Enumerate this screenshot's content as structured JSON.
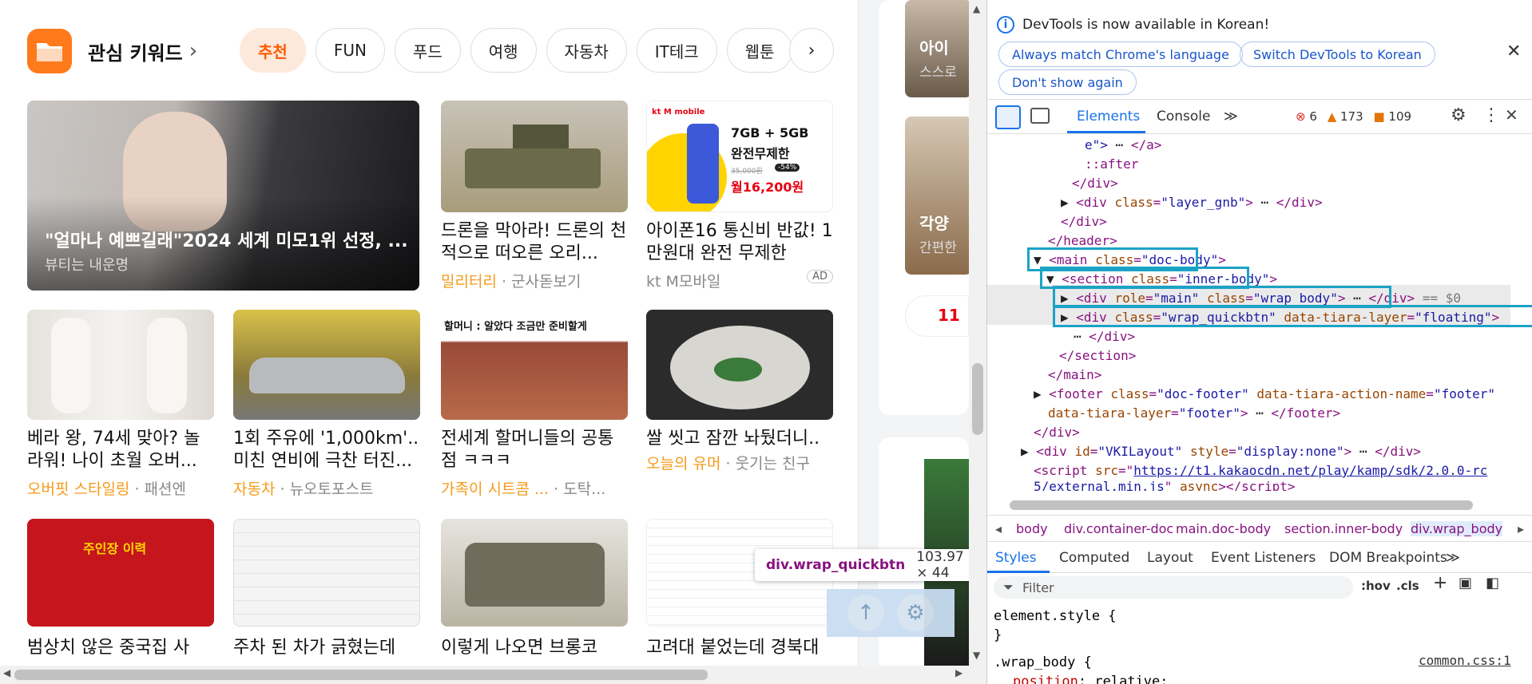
{
  "page": {
    "keyword_title": "관심 키워드",
    "chips": [
      "추천",
      "FUN",
      "푸드",
      "여행",
      "자동차",
      "IT테크",
      "웹툰"
    ],
    "hero": {
      "title": "\"얼마나 예쁘길래\"2024 세계 미모1위 선정, ...",
      "sub": "뷰티는 내운명"
    },
    "cards_row1": [
      {
        "title": "드론을 막아라! 드론의 천적으로 떠오른 오리...",
        "cat": "밀리터리",
        "src": "군사돋보기"
      },
      {
        "title": "아이폰16 통신비 반값! 1만원대 완전 무제한",
        "cat": "",
        "src": "kt M모바일",
        "ad": "AD"
      }
    ],
    "cards_row2": [
      {
        "title": "베라 왕, 74세 맞아? 놀라워! 나이 초월 오버...",
        "cat": "오버핏 스타일링",
        "src": "패션엔"
      },
      {
        "title": "1회 주유에 '1,000km'.. 미친 연비에 극찬 터진...",
        "cat": "자동차",
        "src": "뉴오토포스트"
      },
      {
        "title": "전세계 할머니들의 공통점 ㅋㅋㅋ",
        "cat": "가족이 시트콤 ...",
        "src": "도탁..."
      },
      {
        "title": "쌀 씻고 잠깐 놔뒀더니..",
        "cat": "오늘의 유머",
        "src": "웃기는 친구"
      }
    ],
    "cards_row3": [
      {
        "title": "범상치 않은 중국집 사"
      },
      {
        "title": "주차 된 차가 긁혔는데"
      },
      {
        "title": "이렇게 나오면 브롱코"
      },
      {
        "title": "고려대 붙었는데 경북대"
      }
    ],
    "ad_banner": {
      "line1": "7GB + 5GB",
      "line2": "완전무제한",
      "price_old": "35,000원",
      "badge": "-54%",
      "price": "월16,200원",
      "brand": "kt M mobile"
    },
    "thumb_text": {
      "grandma": "할머니 : 알았다 조금만 준비할게",
      "chinese": "주인장 이력"
    },
    "side": {
      "t1": "아이 ",
      "t1b": "스스로",
      "t2": "각양",
      "t2b": "간편한",
      "logo": "11"
    },
    "tooltip": {
      "selector": "div.wrap_quickbtn",
      "size": "103.97 × 44"
    }
  },
  "devtools": {
    "notice": "DevTools is now available in Korean!",
    "btn_match": "Always match Chrome's language",
    "btn_switch": "Switch DevTools to Korean",
    "btn_dont": "Don't show again",
    "tabs": {
      "elements": "Elements",
      "console": "Console",
      "more": "≫"
    },
    "counts": {
      "errors": "6",
      "warnings": "173",
      "issues": "109"
    },
    "crumbs": [
      "body",
      "div.container-doc",
      "main.doc-body",
      "section.inner-body",
      "div.wrap_body"
    ],
    "style_tabs": [
      "Styles",
      "Computed",
      "Layout",
      "Event Listeners",
      "DOM Breakpoints",
      "≫"
    ],
    "filter_placeholder": "Filter",
    "hov": ":hov",
    "cls": ".cls",
    "styles": {
      "l1": "element.style {",
      "l2": "}",
      "l3": ".wrap_body {",
      "l4": "position",
      "l4v": "relative;",
      "src": "common.css:1"
    },
    "dom": {
      "l1a": "e\">",
      "l1b": "</a>",
      "after": "::after",
      "div_close": "</div>",
      "layer_gnb_attr": "class",
      "layer_gnb_val": "\"layer_gnb\"",
      "header_close": "</header>",
      "main_val": "\"doc-body\"",
      "section_val": "\"inner-body\"",
      "wrap_body_role": "\"main\"",
      "wrap_body_val": "\"wrap_body\"",
      "eq": "== $0",
      "quick_val": "\"wrap_quickbtn\"",
      "quick_tiara": "data-tiara-layer",
      "quick_tiara_val": "\"floating\"",
      "section_close": "</section>",
      "main_close": "</main>",
      "footer_val": "\"doc-footer\"",
      "footer_action": "data-tiara-action-name",
      "footer_action_val": "\"footer\"",
      "footer_layer": "data-tiara-layer",
      "footer_layer_val": "\"footer\"",
      "footer_close": "</footer>",
      "vki_id": "\"VKILayout\"",
      "vki_style": "\"display:none\"",
      "script_src": "https://t1.kakaocdn.net/play/kamp/sdk/2.0.0-rc",
      "script_src2": "5/external.min.js",
      "async": "async"
    }
  }
}
